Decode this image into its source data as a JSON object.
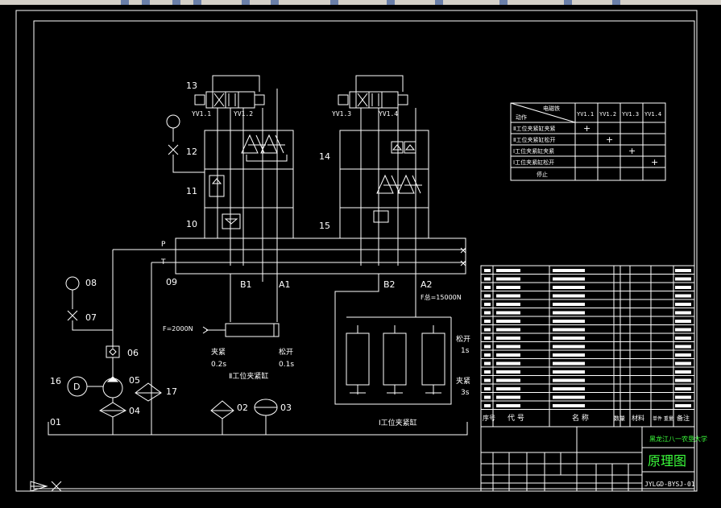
{
  "components": {
    "c13": "13",
    "c12": "12",
    "c11": "11",
    "c10": "10",
    "c14": "14",
    "c15": "15",
    "c09": "09",
    "c08": "08",
    "c07": "07",
    "c06": "06",
    "c05": "05",
    "c04": "04",
    "c16": "16",
    "c17": "17",
    "c02": "02",
    "c03": "03",
    "c01": "01"
  },
  "valves": {
    "yv11": "YV1.1",
    "yv12": "YV1.2",
    "yv13": "YV1.3",
    "yv14": "YV1.4"
  },
  "ports": {
    "P": "P",
    "T": "T",
    "B1": "B1",
    "A1": "A1",
    "B2": "B2",
    "A2": "A2"
  },
  "motor": "D",
  "cyl2": {
    "force": "F=2000N",
    "clamp": "夹紧",
    "clamp_time": "0.2s",
    "release": "松开",
    "release_time": "0.1s",
    "title": "Ⅱ工位夹紧缸"
  },
  "cyl1": {
    "force": "F总=15000N",
    "release": "松开",
    "release_time": "1s",
    "clamp": "夹紧",
    "clamp_time": "3s",
    "title": "Ⅰ工位夹紧缸"
  },
  "table": {
    "hdr_top": "电磁铁",
    "hdr_left": "动作",
    "cols": [
      "YV1.1",
      "YV1.2",
      "YV1.3",
      "YV1.4"
    ],
    "rows": [
      {
        "label": "Ⅱ工位夹紧缸夹紧",
        "marks": [
          "+",
          "",
          "",
          ""
        ]
      },
      {
        "label": "Ⅱ工位夹紧缸松开",
        "marks": [
          "",
          "+",
          "",
          ""
        ]
      },
      {
        "label": "Ⅰ工位夹紧缸夹紧",
        "marks": [
          "",
          "",
          "+",
          ""
        ]
      },
      {
        "label": "Ⅰ工位夹紧缸松开",
        "marks": [
          "",
          "",
          "",
          "+"
        ]
      },
      {
        "label": "停止",
        "marks": [
          "",
          "",
          "",
          ""
        ]
      }
    ]
  },
  "bom_header": {
    "seq": "序号",
    "code": "代 号",
    "name": "名 称",
    "qty": "数量",
    "material": "材料",
    "weight": "单件 重量",
    "note": "备注"
  },
  "title_block": {
    "university": "黑龙江八一农垦大学",
    "drawing_title": "原理图",
    "drawing_no": "JYLGD-BYSJ-01"
  }
}
